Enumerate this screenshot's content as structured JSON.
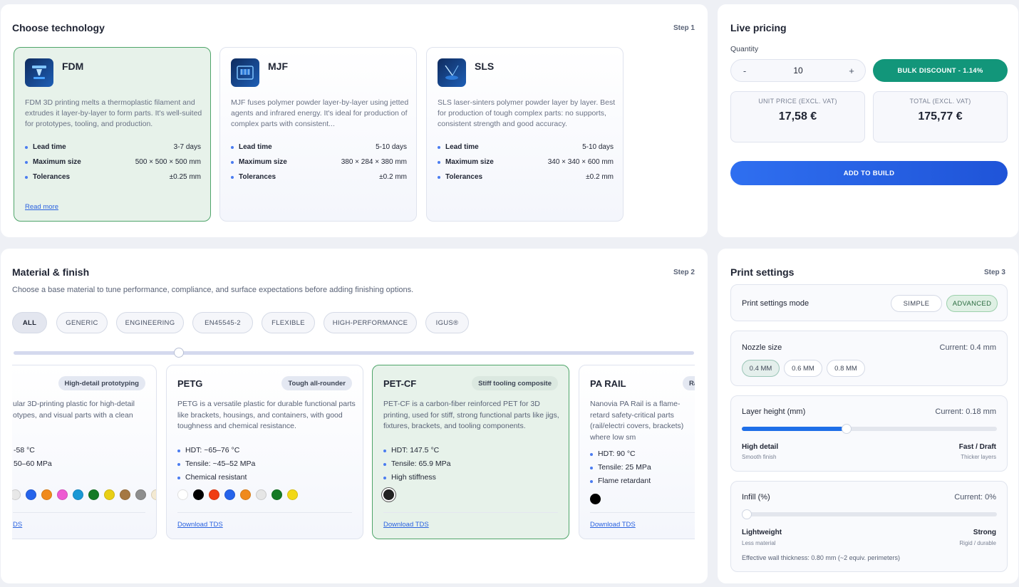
{
  "technology": {
    "title": "Choose technology",
    "step": "Step 1",
    "cards": [
      {
        "name": "FDM",
        "desc": "FDM 3D printing melts a thermoplastic filament and extrudes it layer-by-layer to form parts. It's well-suited for prototypes, tooling, and production.",
        "lead_label": "Lead time",
        "lead": "3-7 days",
        "size_label": "Maximum size",
        "size": "500 × 500 × 500 mm",
        "tol_label": "Tolerances",
        "tol": "±0.25 mm",
        "read_more": "Read more"
      },
      {
        "name": "MJF",
        "desc": "MJF fuses polymer powder layer-by-layer using jetted agents and infrared energy. It's ideal for production of complex parts with consistent...",
        "lead_label": "Lead time",
        "lead": "5-10 days",
        "size_label": "Maximum size",
        "size": "380 × 284 × 380 mm",
        "tol_label": "Tolerances",
        "tol": "±0.2 mm"
      },
      {
        "name": "SLS",
        "desc": "SLS laser-sinters polymer powder layer by layer. Best for production of tough complex parts: no supports, consistent strength and good accuracy.",
        "lead_label": "Lead time",
        "lead": "5-10 days",
        "size_label": "Maximum size",
        "size": "340 × 340 × 600 mm",
        "tol_label": "Tolerances",
        "tol": "±0.2 mm"
      }
    ]
  },
  "pricing": {
    "title": "Live pricing",
    "quantity_label": "Quantity",
    "minus": "-",
    "plus": "+",
    "quantity": "10",
    "bulk": "BULK DISCOUNT - 1.14%",
    "unit_label": "UNIT PRICE (EXCL. VAT)",
    "unit_price": "17,58 €",
    "total_label": "TOTAL (EXCL. VAT)",
    "total": "175,77 €",
    "add_button": "ADD TO BUILD"
  },
  "material": {
    "title": "Material & finish",
    "step": "Step 2",
    "subtitle": "Choose a base material to tune performance, compliance, and surface expectations before adding finishing options.",
    "chips": [
      "ALL",
      "GENERIC",
      "ENGINEERING",
      "EN45545-2",
      "FLEXIBLE",
      "HIGH-PERFORMANCE",
      "IGUS®"
    ],
    "scroll_position": 0.24,
    "cards": [
      {
        "name": "",
        "tag": "High-detail prototyping",
        "desc": "ular 3D-printing plastic for high-detail otypes, and visual parts with a clean",
        "props": [
          "-58 °C",
          "50–60 MPa"
        ],
        "tds": "DS",
        "swatches": [
          "#e8e8e8",
          "#2563eb",
          "#f08a1c",
          "#ee5ad2",
          "#1a98d5",
          "#157a25",
          "#e9cf15",
          "#a57843",
          "#8e8e8e",
          "#f4ead2"
        ]
      },
      {
        "name": "PETG",
        "tag": "Tough all-rounder",
        "desc": "PETG is a versatile plastic for durable functional parts like brackets, housings, and containers, with good toughness and chemical resistance.",
        "props": [
          "HDT: ~65–76 °C",
          "Tensile: ~45–52 MPa",
          "Chemical resistant"
        ],
        "tds": "Download TDS",
        "swatches": [
          "#ffffff",
          "#000000",
          "#f03c12",
          "#2563eb",
          "#f08a1c",
          "#e6e6e6",
          "#157a25",
          "#f2d816"
        ]
      },
      {
        "name": "PET-CF",
        "tag": "Stiff tooling composite",
        "desc": "PET-CF is a carbon-fiber reinforced PET for 3D printing, used for stiff, strong functional parts like jigs, fixtures, brackets, and tooling components.",
        "props": [
          "HDT: 147.5 °C",
          "Tensile: 65.9 MPa",
          "High stiffness"
        ],
        "tds": "Download TDS",
        "swatches": [
          "#222222"
        ]
      },
      {
        "name": "PA RAIL",
        "tag": "Ra",
        "desc": "Nanovia PA Rail is a flame-retard safety-critical parts (rail/electri covers, brackets) where low sm",
        "props": [
          "HDT: 90 °C",
          "Tensile: 25 MPa",
          "Flame retardant"
        ],
        "tds": "Download TDS",
        "swatches": [
          "#000000"
        ]
      }
    ]
  },
  "print": {
    "title": "Print settings",
    "step": "Step 3",
    "mode_label": "Print settings mode",
    "mode_simple": "SIMPLE",
    "mode_advanced": "ADVANCED",
    "nozzle_label": "Nozzle size",
    "nozzle_current": "Current: 0.4 mm",
    "nozzles": [
      "0.4 MM",
      "0.6 MM",
      "0.8 MM"
    ],
    "layer_label": "Layer height (mm)",
    "layer_current": "Current: 0.18 mm",
    "layer_position": 0.41,
    "layer_left": "High detail",
    "layer_left_sub": "Smooth finish",
    "layer_right": "Fast / Draft",
    "layer_right_sub": "Thicker layers",
    "infill_label": "Infill (%)",
    "infill_current": "Current: 0%",
    "infill_position": 0,
    "infill_left": "Lightweight",
    "infill_left_sub": "Less material",
    "infill_right": "Strong",
    "infill_right_sub": "Rigid / durable",
    "wall": "Effective wall thickness: 0.80 mm (~2 equiv. perimeters)"
  },
  "colors": {
    "accent_blue": "#1f6fe8",
    "bulk_green": "#12967a",
    "selected_bg": "#e7f2ea",
    "selected_border": "#4fa56a"
  }
}
